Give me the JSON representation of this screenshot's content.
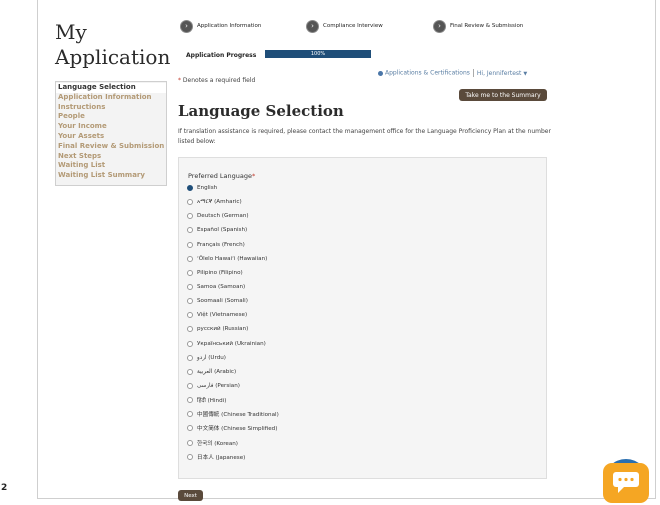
{
  "app_title": "My Application",
  "sidebar": {
    "items": [
      {
        "label": "Language Selection",
        "active": true
      },
      {
        "label": "Application Information",
        "active": false
      },
      {
        "label": "Instructions",
        "active": false
      },
      {
        "label": "People",
        "active": false
      },
      {
        "label": "Your Income",
        "active": false
      },
      {
        "label": "Your Assets",
        "active": false
      },
      {
        "label": "Final Review & Submission",
        "active": false
      },
      {
        "label": "Next Steps",
        "active": false
      },
      {
        "label": "Waiting List",
        "active": false
      },
      {
        "label": "Waiting List Summary",
        "active": false
      }
    ]
  },
  "steps": [
    {
      "label": "Application Information"
    },
    {
      "label": "Compliance Interview"
    },
    {
      "label": "Final Review & Submission"
    }
  ],
  "progress": {
    "label": "Application Progress",
    "value_text": "100%",
    "fraction": 1.0
  },
  "userbar": {
    "link": "Applications & Certifications",
    "greeting": "Hi, Jennifertest",
    "caret": "▼"
  },
  "required_note": {
    "star": "*",
    "text": " Denotes a required field"
  },
  "summary_button": "Take me to the Summary",
  "page_title": "Language Selection",
  "intro": "If translation assistance is required, please contact the management office for the Language Proficiency Plan at the number listed below:",
  "form": {
    "field_label": "Preferred Language",
    "required_star": "*",
    "selected": "English",
    "options": [
      "English",
      "አማርኛ (Amharic)",
      "Deutsch (German)",
      "Español (Spanish)",
      "Français (French)",
      "ʻŌlelo Hawaiʻi (Hawaiian)",
      "Pilipino (Filipino)",
      "Samoa (Samoan)",
      "Soomaali (Somali)",
      "Việt (Vietnamese)",
      "русский (Russian)",
      "Українськиӣ (Ukrainian)",
      "اردو (Urdu)",
      "العربية (Arabic)",
      "فارسی (Persian)",
      "हिंदी (Hindi)",
      "中國傳統 (Chinese Traditional)",
      "中文简体 (Chinese Simplified)",
      "한국의 (Korean)",
      "日本人 (Japanese)"
    ]
  },
  "next_button": "Next",
  "stray_char": "2",
  "colors": {
    "accent_brown": "#5a4a3b",
    "progress_blue": "#1f4e79",
    "nav_gold": "#b39a76",
    "chat_orange": "#f5a623"
  },
  "icons": {
    "step": "chevron-right-icon",
    "chat": "chat-bubble-icon"
  }
}
